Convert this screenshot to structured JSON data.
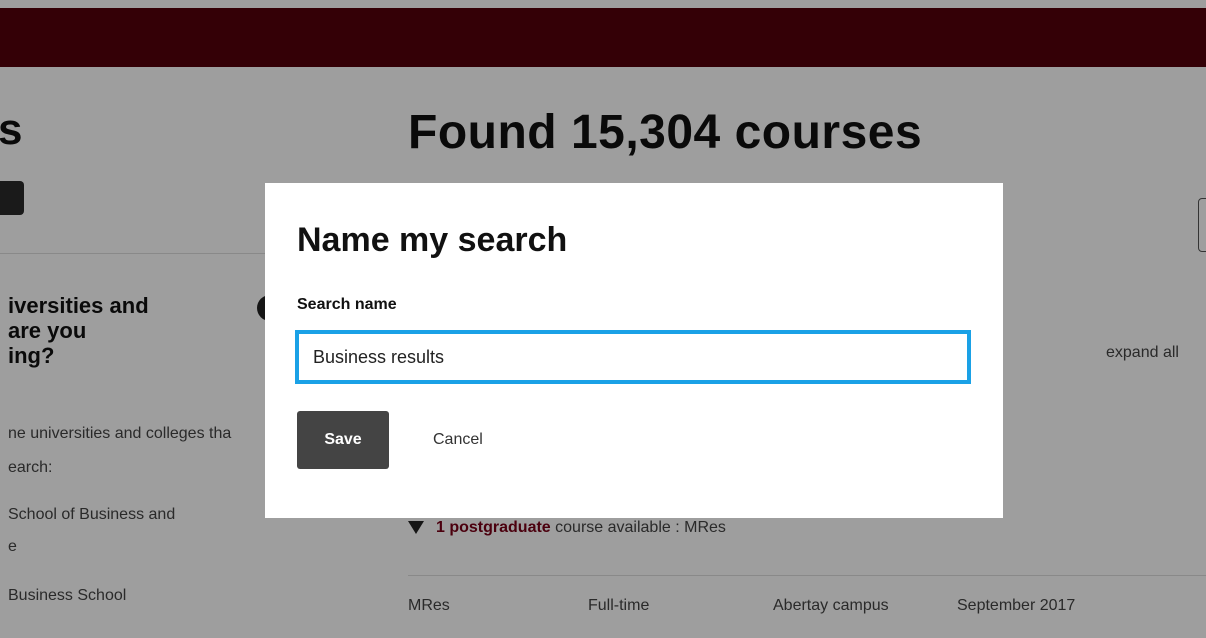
{
  "header": {
    "bar_color": "#54000b"
  },
  "left_panel": {
    "title_fragment": "s",
    "heading_lines": [
      "iversities and",
      "are you",
      "ing?"
    ],
    "description_lines": [
      "ne universities and colleges tha",
      "earch:"
    ],
    "university_1_lines": [
      "School of Business and",
      "e"
    ],
    "university_2": "Business School"
  },
  "results": {
    "title": "Found 15,304 courses",
    "expand_all": "expand all",
    "postgrad_count": "1",
    "postgrad_label": "postgraduate",
    "postgrad_suffix": " course available : MRes",
    "row": {
      "qualification": "MRes",
      "mode": "Full-time",
      "campus": "Abertay campus",
      "start": "September 2017"
    }
  },
  "modal": {
    "title": "Name my search",
    "field_label": "Search name",
    "field_value": "Business results",
    "save_label": "Save",
    "cancel_label": "Cancel",
    "focus_color": "#1aa1e6"
  }
}
